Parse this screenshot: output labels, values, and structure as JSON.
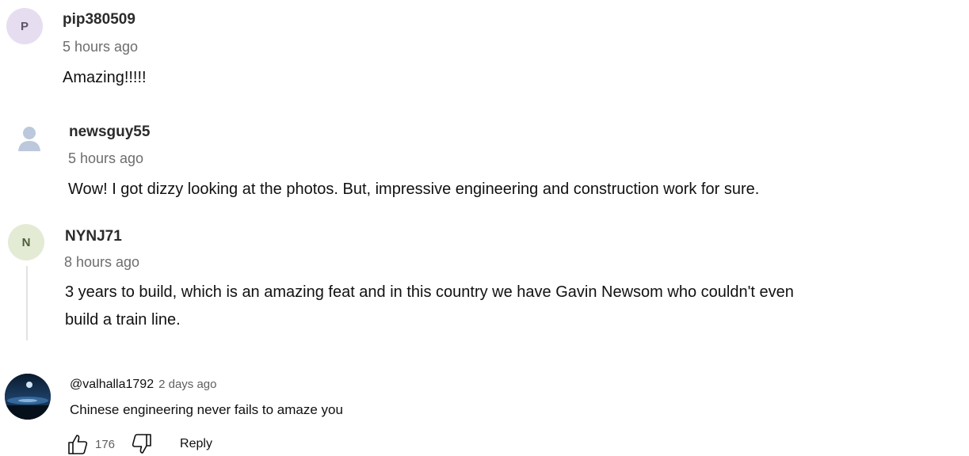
{
  "comments": [
    {
      "avatar_letter": "P",
      "username": "pip380509",
      "time": "5 hours ago",
      "text": "Amazing!!!!!"
    },
    {
      "avatar_icon": "user-silhouette-icon",
      "username": "newsguy55",
      "time": "5 hours ago",
      "text": "Wow! I got dizzy looking at the photos. But, impressive engineering and construction work for sure."
    },
    {
      "avatar_letter": "N",
      "username": "NYNJ71",
      "time": "8 hours ago",
      "text_line1": "3 years to build, which is an amazing feat and in this country we have Gavin Newsom who couldn't even",
      "text_line2": "build a train line."
    }
  ],
  "yt_comment": {
    "handle": "@valhalla1792",
    "time": "2 days ago",
    "text": "Chinese engineering never fails to amaze you",
    "like_count": "176",
    "reply_label": "Reply"
  },
  "colors": {
    "avatar_p_bg": "#e6def0",
    "avatar_n_bg": "#e3ebd4",
    "muted_text": "#6d6d6d"
  }
}
